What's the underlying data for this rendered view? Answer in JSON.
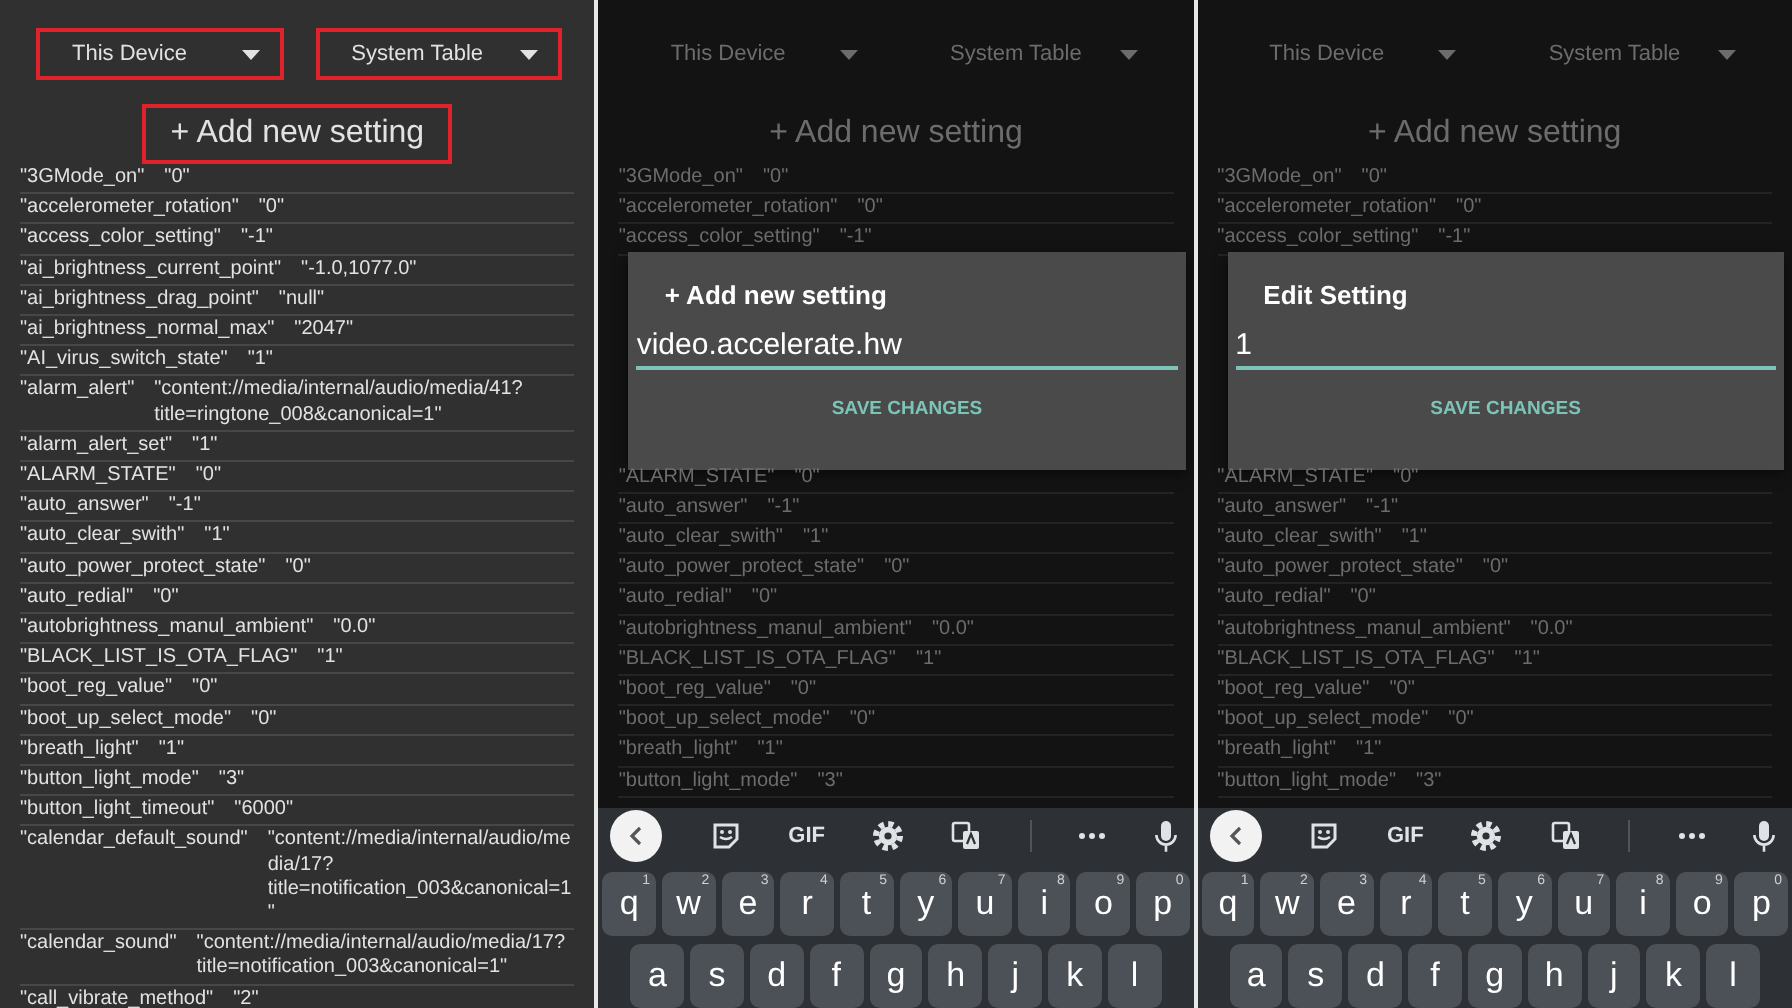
{
  "panels": [
    {
      "device_dropdown": {
        "label": "This Device",
        "highlighted": true
      },
      "table_dropdown": {
        "label": "System Table",
        "highlighted": true
      },
      "add_button": {
        "label": "+ Add new setting",
        "highlighted": true
      },
      "settings": [
        {
          "name": "\"3GMode_on\"",
          "value": "\"0\""
        },
        {
          "name": "\"accelerometer_rotation\"",
          "value": "\"0\""
        },
        {
          "name": "\"access_color_setting\"",
          "value": "\"-1\""
        },
        {
          "name": "\"ai_brightness_current_point\"",
          "value": "\"-1.0,1077.0\""
        },
        {
          "name": "\"ai_brightness_drag_point\"",
          "value": "\"null\""
        },
        {
          "name": "\"ai_brightness_normal_max\"",
          "value": "\"2047\""
        },
        {
          "name": "\"AI_virus_switch_state\"",
          "value": "\"1\""
        },
        {
          "name": "\"alarm_alert\"",
          "value": "\"content://media/internal/audio/media/41?title=ringtone_008&canonical=1\""
        },
        {
          "name": "\"alarm_alert_set\"",
          "value": "\"1\""
        },
        {
          "name": "\"ALARM_STATE\"",
          "value": "\"0\""
        },
        {
          "name": "\"auto_answer\"",
          "value": "\"-1\""
        },
        {
          "name": "\"auto_clear_swith\"",
          "value": "\"1\""
        },
        {
          "name": "\"auto_power_protect_state\"",
          "value": "\"0\""
        },
        {
          "name": "\"auto_redial\"",
          "value": "\"0\""
        },
        {
          "name": "\"autobrightness_manul_ambient\"",
          "value": "\"0.0\""
        },
        {
          "name": "\"BLACK_LIST_IS_OTA_FLAG\"",
          "value": "\"1\""
        },
        {
          "name": "\"boot_reg_value\"",
          "value": "\"0\""
        },
        {
          "name": "\"boot_up_select_mode\"",
          "value": "\"0\""
        },
        {
          "name": "\"breath_light\"",
          "value": "\"1\""
        },
        {
          "name": "\"button_light_mode\"",
          "value": "\"3\""
        },
        {
          "name": "\"button_light_timeout\"",
          "value": "\"6000\""
        },
        {
          "name": "\"calendar_default_sound\"",
          "value": "\"content://media/internal/audio/media/17?title=notification_003&canonical=1\""
        },
        {
          "name": "\"calendar_sound\"",
          "value": "\"content://media/internal/audio/media/17?title=notification_003&canonical=1\""
        },
        {
          "name": "\"call_vibrate_method\"",
          "value": "\"2\""
        }
      ]
    },
    {
      "device_dropdown": {
        "label": "This Device",
        "highlighted": false
      },
      "table_dropdown": {
        "label": "System Table",
        "highlighted": false
      },
      "add_button": {
        "label": "+ Add new setting",
        "highlighted": false
      },
      "settings": [
        {
          "name": "\"3GMode_on\"",
          "value": "\"0\""
        },
        {
          "name": "\"accelerometer_rotation\"",
          "value": "\"0\""
        },
        {
          "name": "\"access_color_setting\"",
          "value": "\"-1\""
        }
      ],
      "dialog": {
        "title": "+ Add new setting",
        "value": "video.accelerate.hw",
        "button": "SAVE CHANGES"
      },
      "settings_below_dialog": [
        {
          "name": "\"ALARM_STATE\"",
          "value": "\"0\""
        },
        {
          "name": "\"auto_answer\"",
          "value": "\"-1\""
        },
        {
          "name": "\"auto_clear_swith\"",
          "value": "\"1\""
        },
        {
          "name": "\"auto_power_protect_state\"",
          "value": "\"0\""
        },
        {
          "name": "\"auto_redial\"",
          "value": "\"0\""
        },
        {
          "name": "\"autobrightness_manul_ambient\"",
          "value": "\"0.0\""
        },
        {
          "name": "\"BLACK_LIST_IS_OTA_FLAG\"",
          "value": "\"1\""
        },
        {
          "name": "\"boot_reg_value\"",
          "value": "\"0\""
        },
        {
          "name": "\"boot_up_select_mode\"",
          "value": "\"0\""
        },
        {
          "name": "\"breath_light\"",
          "value": "\"1\""
        },
        {
          "name": "\"button_light_mode\"",
          "value": "\"3\""
        }
      ],
      "keyboard": {
        "gif_label": "GIF",
        "rows": [
          [
            {
              "key": "q",
              "hint": "1"
            },
            {
              "key": "w",
              "hint": "2"
            },
            {
              "key": "e",
              "hint": "3"
            },
            {
              "key": "r",
              "hint": "4"
            },
            {
              "key": "t",
              "hint": "5"
            },
            {
              "key": "y",
              "hint": "6"
            },
            {
              "key": "u",
              "hint": "7"
            },
            {
              "key": "i",
              "hint": "8"
            },
            {
              "key": "o",
              "hint": "9"
            },
            {
              "key": "p",
              "hint": "0"
            }
          ],
          [
            {
              "key": "a"
            },
            {
              "key": "s"
            },
            {
              "key": "d"
            },
            {
              "key": "f"
            },
            {
              "key": "g"
            },
            {
              "key": "h"
            },
            {
              "key": "j"
            },
            {
              "key": "k"
            },
            {
              "key": "l"
            }
          ]
        ]
      }
    },
    {
      "device_dropdown": {
        "label": "This Device",
        "highlighted": false
      },
      "table_dropdown": {
        "label": "System Table",
        "highlighted": false
      },
      "add_button": {
        "label": "+ Add new setting",
        "highlighted": false
      },
      "settings": [
        {
          "name": "\"3GMode_on\"",
          "value": "\"0\""
        },
        {
          "name": "\"accelerometer_rotation\"",
          "value": "\"0\""
        },
        {
          "name": "\"access_color_setting\"",
          "value": "\"-1\""
        }
      ],
      "dialog": {
        "title": "Edit Setting",
        "value": "1",
        "button": "SAVE CHANGES"
      },
      "settings_below_dialog": [
        {
          "name": "\"ALARM_STATE\"",
          "value": "\"0\""
        },
        {
          "name": "\"auto_answer\"",
          "value": "\"-1\""
        },
        {
          "name": "\"auto_clear_swith\"",
          "value": "\"1\""
        },
        {
          "name": "\"auto_power_protect_state\"",
          "value": "\"0\""
        },
        {
          "name": "\"auto_redial\"",
          "value": "\"0\""
        },
        {
          "name": "\"autobrightness_manul_ambient\"",
          "value": "\"0.0\""
        },
        {
          "name": "\"BLACK_LIST_IS_OTA_FLAG\"",
          "value": "\"1\""
        },
        {
          "name": "\"boot_reg_value\"",
          "value": "\"0\""
        },
        {
          "name": "\"boot_up_select_mode\"",
          "value": "\"0\""
        },
        {
          "name": "\"breath_light\"",
          "value": "\"1\""
        },
        {
          "name": "\"button_light_mode\"",
          "value": "\"3\""
        }
      ],
      "keyboard": {
        "gif_label": "GIF",
        "rows": [
          [
            {
              "key": "q",
              "hint": "1"
            },
            {
              "key": "w",
              "hint": "2"
            },
            {
              "key": "e",
              "hint": "3"
            },
            {
              "key": "r",
              "hint": "4"
            },
            {
              "key": "t",
              "hint": "5"
            },
            {
              "key": "y",
              "hint": "6"
            },
            {
              "key": "u",
              "hint": "7"
            },
            {
              "key": "i",
              "hint": "8"
            },
            {
              "key": "o",
              "hint": "9"
            },
            {
              "key": "p",
              "hint": "0"
            }
          ],
          [
            {
              "key": "a"
            },
            {
              "key": "s"
            },
            {
              "key": "d"
            },
            {
              "key": "f"
            },
            {
              "key": "g"
            },
            {
              "key": "h"
            },
            {
              "key": "j"
            },
            {
              "key": "k"
            },
            {
              "key": "l"
            }
          ]
        ]
      }
    }
  ]
}
